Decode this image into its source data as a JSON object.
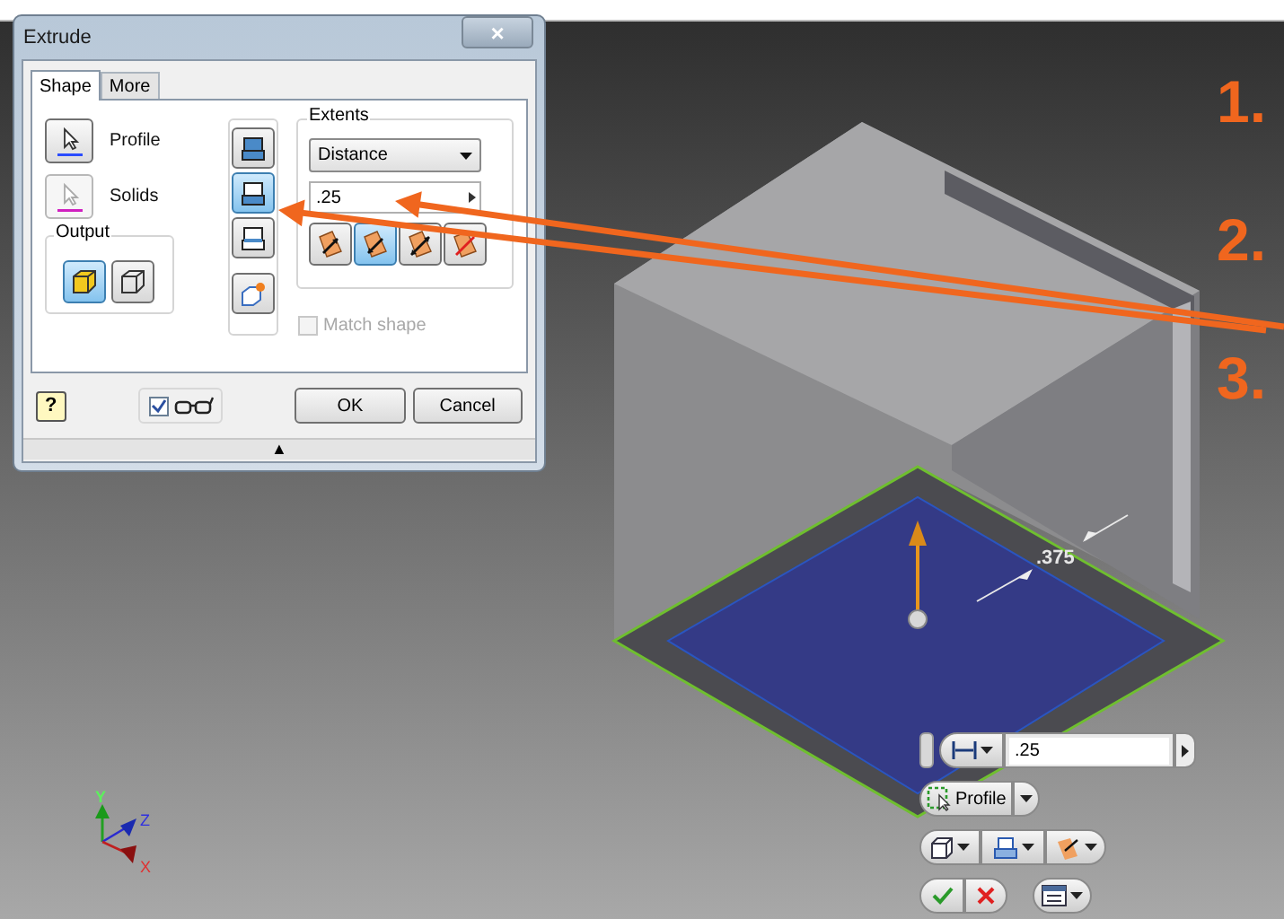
{
  "dialog": {
    "title": "Extrude",
    "close": "×",
    "tabs": [
      {
        "label": "Shape",
        "selected": true
      },
      {
        "label": "More",
        "selected": false
      }
    ],
    "selectors": [
      {
        "kind": "profile",
        "label": "Profile",
        "active": true
      },
      {
        "kind": "solids",
        "label": "Solids",
        "active": false
      }
    ],
    "output": {
      "title": "Output",
      "modes": [
        {
          "kind": "solid",
          "selected": true
        },
        {
          "kind": "surface",
          "selected": false
        }
      ]
    },
    "operations": [
      {
        "kind": "join",
        "selected": false
      },
      {
        "kind": "cut",
        "selected": true
      },
      {
        "kind": "intersect",
        "selected": false
      },
      {
        "kind": "new-solid",
        "selected": false
      }
    ],
    "extents": {
      "title": "Extents",
      "type": "Distance",
      "value": ".25",
      "directions": [
        {
          "kind": "one",
          "selected": false
        },
        {
          "kind": "two",
          "selected": true
        },
        {
          "kind": "symmetric",
          "selected": false
        },
        {
          "kind": "asym",
          "selected": false
        }
      ]
    },
    "match_shape": {
      "label": "Match shape",
      "checked": false,
      "disabled": true
    },
    "help": "?",
    "preview_checked": true,
    "buttons": [
      "OK",
      "Cancel"
    ],
    "expand": "▲"
  },
  "callouts": [
    "1.",
    "2.",
    "3."
  ],
  "dimension": ".375",
  "mini_toolbar": {
    "value": ".25",
    "profile": "Profile"
  },
  "axes": [
    "Y",
    "Z",
    "X"
  ]
}
